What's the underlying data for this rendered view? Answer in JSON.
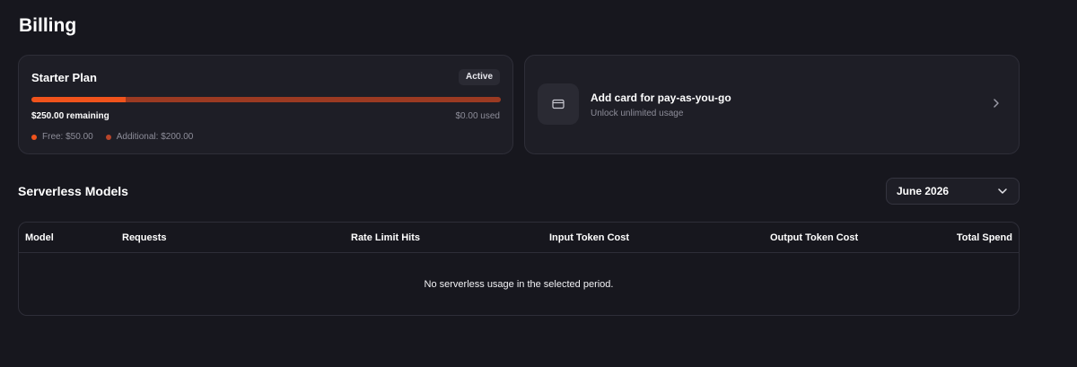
{
  "page": {
    "title": "Billing"
  },
  "plan": {
    "name": "Starter Plan",
    "status": "Active",
    "remaining": "$250.00 remaining",
    "used": "$0.00 used",
    "free_fraction": 0.2,
    "legend": [
      {
        "label": "Free: $50.00",
        "color": "#f0531c"
      },
      {
        "label": "Additional: $200.00",
        "color": "#b8452a"
      }
    ]
  },
  "add_card": {
    "icon": "credit-card-icon",
    "title": "Add card for pay-as-you-go",
    "subtitle": "Unlock unlimited usage"
  },
  "serverless": {
    "title": "Serverless Models",
    "period": {
      "selected": "June 2026"
    },
    "columns": [
      "Model",
      "Requests",
      "Rate Limit Hits",
      "Input Token Cost",
      "Output Token Cost",
      "Total Spend"
    ],
    "empty_message": "No serverless usage in the selected period."
  },
  "colors": {
    "background": "#17171e",
    "accent": "#f0531c",
    "accent_dark": "#9b3a22"
  }
}
